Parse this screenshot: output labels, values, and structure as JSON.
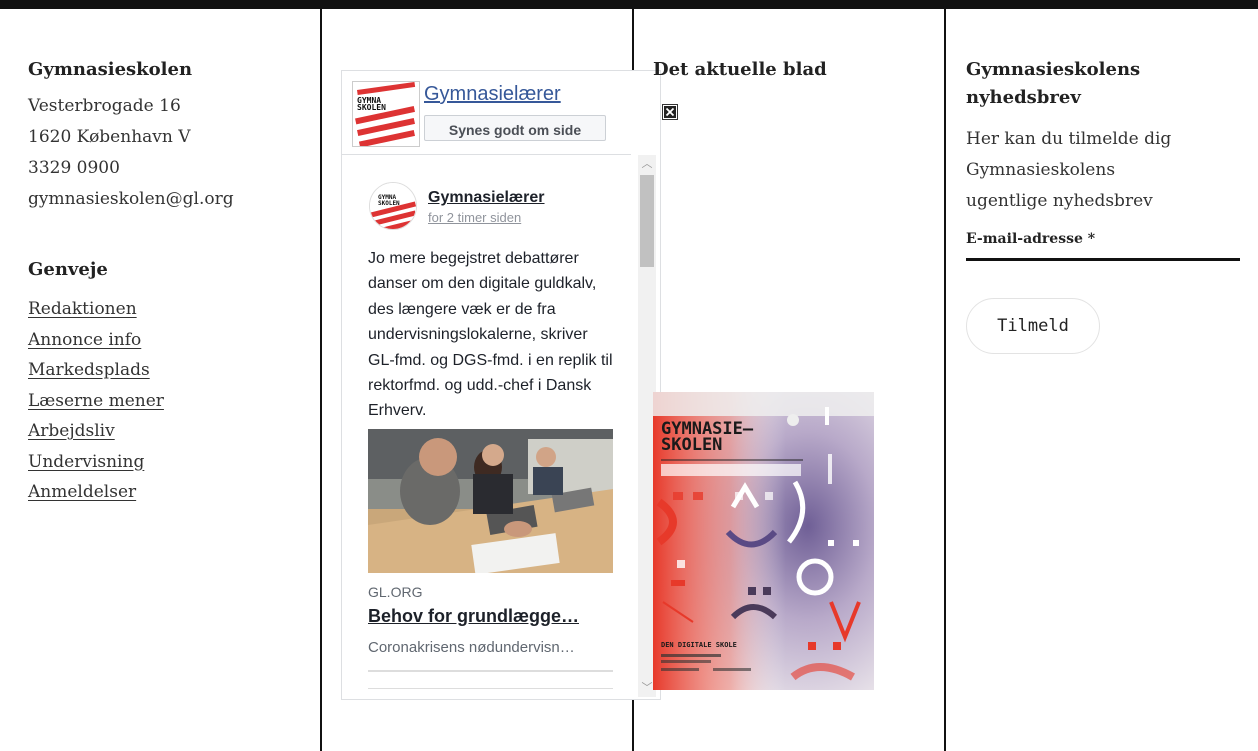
{
  "contact": {
    "heading": "Gymnasieskolen",
    "address1": "Vesterbrogade 16",
    "address2": "1620 København V",
    "phone": "3329 0900",
    "email": "gymnasieskolen@gl.org"
  },
  "shortcuts": {
    "heading": "Genveje",
    "links": [
      "Redaktionen",
      "Annonce info",
      "Markedsplads",
      "Læserne mener",
      "Arbejdsliv",
      "Undervisning",
      "Anmeldelser"
    ]
  },
  "facebook": {
    "page_name": "Gymnasielærer",
    "like_label": "Synes godt om side",
    "post": {
      "author": "Gymnasielærer",
      "time": "for 2 timer siden",
      "text": "Jo mere begejstret debattører danser om den digitale guldkalv, des længere væk er de fra undervisningslokalerne, skriver GL-fmd. og DGS-fmd. i en replik til rektorfmd. og udd.-chef i Dansk Erhverv.",
      "link_domain": "GL.ORG",
      "link_title": "Behov for grundlægge…",
      "link_desc": "Coronakrisens nødundervisn…"
    }
  },
  "magazine": {
    "heading": "Det aktuelle blad",
    "cover": {
      "masthead_1": "GYMNASIE–",
      "masthead_2": "SKOLEN",
      "theme": "DEN DIGITALE SKOLE"
    }
  },
  "newsletter": {
    "heading_1": "Gymnasieskolens",
    "heading_2": "nyhedsbrev",
    "desc_1": "Her kan du tilmelde dig",
    "desc_2": "Gymnasieskolens",
    "desc_3": "ugentlige nyhedsbrev",
    "email_label": "E-mail-adresse *",
    "email_value": "",
    "submit_label": "Tilmeld"
  },
  "colors": {
    "fb_link": "#365899",
    "rule": "#111111"
  }
}
